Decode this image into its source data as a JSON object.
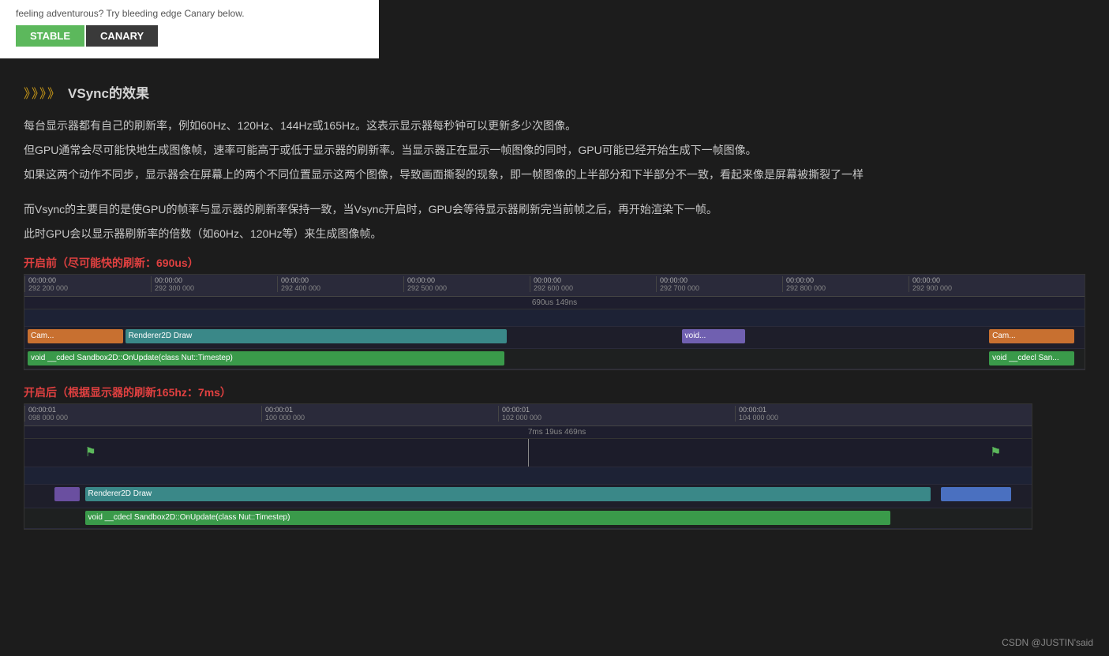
{
  "top": {
    "description": "feeling adventurous? Try bleeding edge Canary below.",
    "btn_stable": "STABLE",
    "btn_canary": "CANARY"
  },
  "vsync_section": {
    "arrows": "》》》》",
    "title": "VSync的效果",
    "paragraphs": [
      "每台显示器都有自己的刷新率，例如60Hz、120Hz、144Hz或165Hz。这表示显示器每秒钟可以更新多少次图像。",
      "但GPU通常会尽可能快地生成图像帧，速率可能高于或低于显示器的刷新率。当显示器正在显示一帧图像的同时，GPU可能已经开始生成下一帧图像。",
      "如果这两个动作不同步，显示器会在屏幕上的两个不同位置显示这两个图像，导致画面撕裂的现象，即一帧图像的上半部分和下半部分不一致，看起来像是屏幕被撕裂了一样",
      "",
      "而Vsync的主要目的是使GPU的帧率与显示器的刷新率保持一致，当Vsync开启时，GPU会等待显示器刷新完当前帧之后，再开始渲染下一帧。",
      "此时GPU会以显示器刷新率的倍数（如60Hz、120Hz等）来生成图像帧。"
    ],
    "before_label": "开启前（尽可能快的刷新：690us）",
    "after_label": "开启后（根据显示器的刷新165hz：7ms）",
    "before_time_marker": "690us 149ns",
    "after_time_marker": "7ms 19us 469ns"
  },
  "timeline_before": {
    "ruler_ticks": [
      {
        "top": "00:00:00",
        "bottom": "292 200 000"
      },
      {
        "top": "00:00:00",
        "bottom": "292 300 000"
      },
      {
        "top": "00:00:00",
        "bottom": "292 400 000"
      },
      {
        "top": "00:00:00",
        "bottom": "292 500 000"
      },
      {
        "top": "00:00:00",
        "bottom": "292 600 000"
      },
      {
        "top": "00:00:00",
        "bottom": "292 700 000"
      },
      {
        "top": "00:00:00",
        "bottom": "292 800 000"
      },
      {
        "top": "00:00:00",
        "bottom": "292 900 000"
      }
    ],
    "tracks": [
      {
        "items": [
          {
            "label": "Cam...",
            "color": "bar-orange",
            "left": "0.5%",
            "width": "10%"
          },
          {
            "label": "Renderer2D Draw",
            "color": "bar-teal",
            "left": "11%",
            "width": "38%"
          },
          {
            "label": "void...",
            "color": "bar-purple",
            "left": "63%",
            "width": "6%"
          },
          {
            "label": "Cam...",
            "color": "bar-orange",
            "left": "91%",
            "width": "7%"
          }
        ]
      },
      {
        "items": [
          {
            "label": "void __cdecl Sandbox2D::OnUpdate(class Nut::Timestep)",
            "color": "bar-green",
            "left": "0.5%",
            "width": "46%"
          },
          {
            "label": "void __cdecl San...",
            "color": "bar-green",
            "left": "91%",
            "width": "8%"
          }
        ]
      }
    ]
  },
  "timeline_after": {
    "ruler_ticks": [
      {
        "top": "00:00:01",
        "bottom": "098 000 000"
      },
      {
        "top": "00:00:01",
        "bottom": "100 000 000"
      },
      {
        "top": "00:00:01",
        "bottom": "102 000 000"
      },
      {
        "top": "00:00:01",
        "bottom": "104 000 000"
      }
    ],
    "tracks": [
      {
        "items": [
          {
            "label": "Renderer2D Draw",
            "color": "bar-teal",
            "left": "7%",
            "width": "83%"
          },
          {
            "label": "",
            "color": "bar-blue",
            "left": "92%",
            "width": "6%"
          }
        ]
      },
      {
        "items": [
          {
            "label": "void __cdecl Sandbox2D::OnUpdate(class Nut::Timestep)",
            "color": "bar-green",
            "left": "7%",
            "width": "80%"
          }
        ]
      }
    ]
  },
  "footer": {
    "attribution": "CSDN @JUSTIN'said"
  }
}
